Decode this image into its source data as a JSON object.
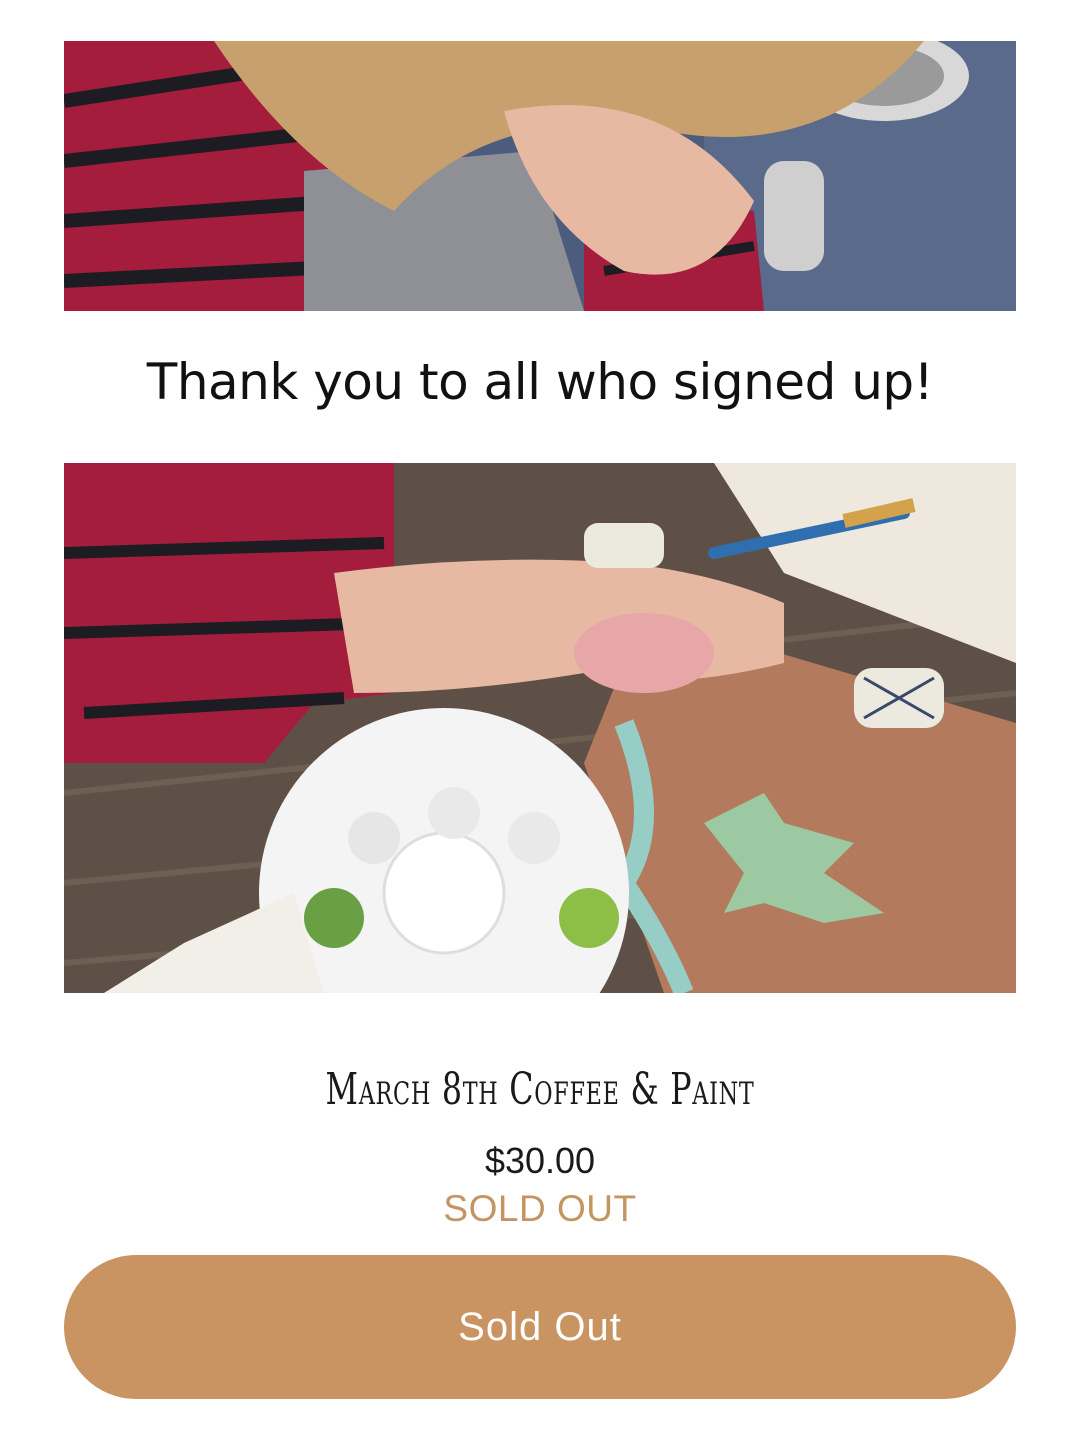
{
  "headline": "Thank you to all who signed up!",
  "product": {
    "title": "March 8th Coffee & Paint",
    "price": "$30.00",
    "status": "SOLD OUT"
  },
  "button": {
    "label": "Sold Out"
  },
  "colors": {
    "accent": "#c99461",
    "status_text": "#c4955f",
    "button_text": "#ffffff"
  }
}
